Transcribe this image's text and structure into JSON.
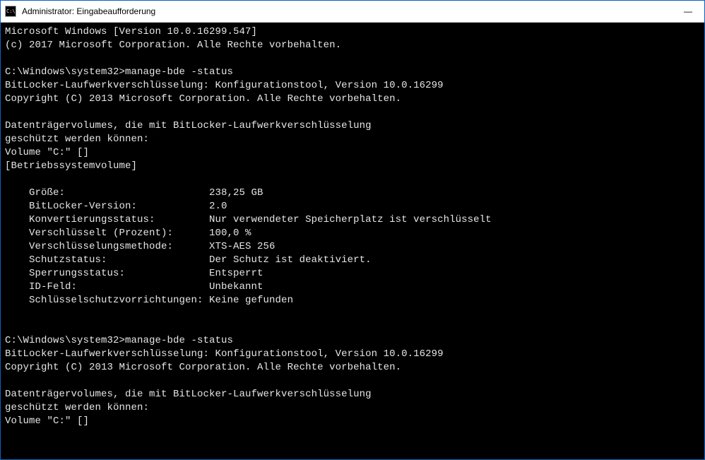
{
  "titlebar": {
    "icon_label": "cmd-icon",
    "icon_text": "C:\\",
    "title": "Administrator: Eingabeaufforderung",
    "minimize_glyph": "—"
  },
  "terminal": {
    "header_os": "Microsoft Windows [Version 10.0.16299.547]",
    "header_copyright": "(c) 2017 Microsoft Corporation. Alle Rechte vorbehalten.",
    "prompt_path": "C:\\Windows\\system32>",
    "command": "manage-bde -status",
    "tool_line": "BitLocker-Laufwerkverschlüsselung: Konfigurationstool, Version 10.0.16299",
    "tool_copyright": "Copyright (C) 2013 Microsoft Corporation. Alle Rechte vorbehalten.",
    "vol_line1": "Datenträgervolumes, die mit BitLocker-Laufwerkverschlüsselung",
    "vol_line2": "geschützt werden können:",
    "vol_label": "Volume \"C:\" []",
    "vol_type": "[Betriebssystemvolume]",
    "fields": {
      "size": {
        "label": "Größe:",
        "value": "238,25 GB"
      },
      "version": {
        "label": "BitLocker-Version:",
        "value": "2.0"
      },
      "conv": {
        "label": "Konvertierungsstatus:",
        "value": "Nur verwendeter Speicherplatz ist verschlüsselt"
      },
      "enc_pct": {
        "label": "Verschlüsselt (Prozent):",
        "value": "100,0 %"
      },
      "enc_method": {
        "label": "Verschlüsselungsmethode:",
        "value": "XTS-AES 256"
      },
      "prot_status": {
        "label": "Schutzstatus:",
        "value": "Der Schutz ist deaktiviert."
      },
      "lock_status": {
        "label": "Sperrungsstatus:",
        "value": "Entsperrt"
      },
      "id_field": {
        "label": "ID-Feld:",
        "value": "Unbekannt"
      },
      "keyprot": {
        "label": "Schlüsselschutzvorrichtungen:",
        "value": "Keine gefunden"
      }
    }
  }
}
